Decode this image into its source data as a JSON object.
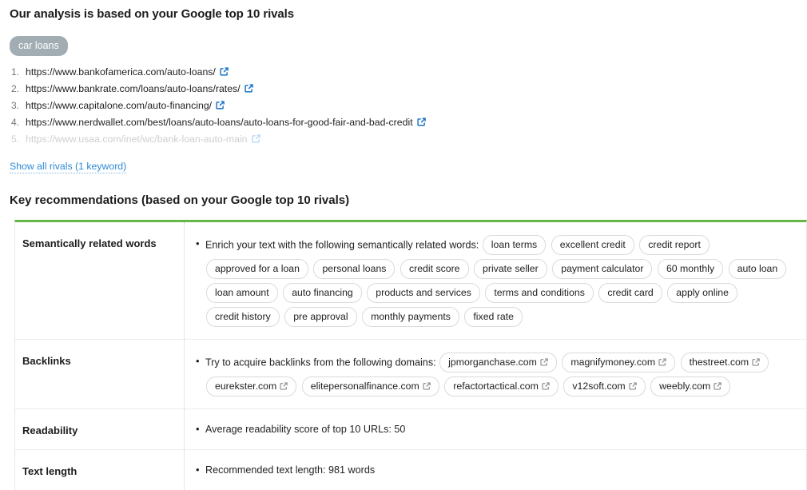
{
  "rivals": {
    "title": "Our analysis is based on your Google top 10 rivals",
    "keyword_badge": "car loans",
    "items": [
      {
        "index": "1.",
        "url": "https://www.bankofamerica.com/auto-loans/",
        "faded": false
      },
      {
        "index": "2.",
        "url": "https://www.bankrate.com/loans/auto-loans/rates/",
        "faded": false
      },
      {
        "index": "3.",
        "url": "https://www.capitalone.com/auto-financing/",
        "faded": false
      },
      {
        "index": "4.",
        "url": "https://www.nerdwallet.com/best/loans/auto-loans/auto-loans-for-good-fair-and-bad-credit",
        "faded": false
      },
      {
        "index": "5.",
        "url": "https://www.usaa.com/inet/wc/bank-loan-auto-main",
        "faded": true
      }
    ],
    "show_all_link": "Show all rivals (1 keyword)"
  },
  "recommendations": {
    "title": "Key recommendations (based on your Google top 10 rivals)",
    "accent_color": "#63b846",
    "rows": [
      {
        "label": "Semantically related words",
        "text": "Enrich your text with the following semantically related words:",
        "tags": [
          "loan terms",
          "excellent credit",
          "credit report",
          "approved for a loan",
          "personal loans",
          "credit score",
          "private seller",
          "payment calculator",
          "60 monthly",
          "auto loan",
          "loan amount",
          "auto financing",
          "products and services",
          "terms and conditions",
          "credit card",
          "apply online",
          "credit history",
          "pre approval",
          "monthly payments",
          "fixed rate"
        ],
        "tag_icon": false
      },
      {
        "label": "Backlinks",
        "text": "Try to acquire backlinks from the following domains:",
        "tags": [
          "jpmorganchase.com",
          "magnifymoney.com",
          "thestreet.com",
          "eurekster.com",
          "elitepersonalfinance.com",
          "refactortactical.com",
          "v12soft.com",
          "weebly.com"
        ],
        "tag_icon": true
      },
      {
        "label": "Readability",
        "text": "Average readability score of top 10 URLs: 50",
        "tags": [],
        "tag_icon": false
      },
      {
        "label": "Text length",
        "text": "Recommended text length: 981 words",
        "tags": [],
        "tag_icon": false
      }
    ]
  },
  "icons": {
    "external_link": "external-link-icon"
  }
}
